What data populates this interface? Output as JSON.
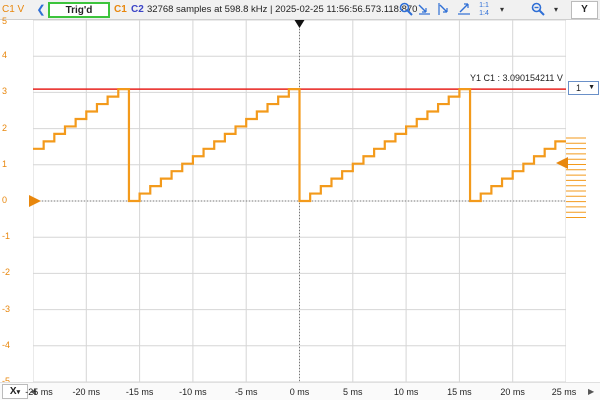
{
  "toolbar": {
    "unit_label": "C1 V",
    "back_icon": "chevron-left-icon",
    "trigger_status": "Trig'd",
    "channel1": "C1",
    "channel2": "C2",
    "acquisition_info": "32768 samples at 598.8 kHz  |  2025-02-25 11:56:56.573.118.870",
    "tools": [
      "zoom-icon",
      "zoom-x-icon",
      "zoom-y-icon",
      "zoom-xy-icon",
      "ratio-icon",
      "zoom-out-icon",
      "zoom-settings-icon"
    ],
    "y_axis_select": "Y"
  },
  "plot": {
    "y_ticks": [
      "5",
      "4",
      "3",
      "2",
      "1",
      "0",
      "-1",
      "-2",
      "-3",
      "-4",
      "-5"
    ],
    "x_ticks": [
      "-25 ms",
      "-20 ms",
      "-15 ms",
      "-10 ms",
      "-5 ms",
      "0 ms",
      "5 ms",
      "10 ms",
      "15 ms",
      "20 ms",
      "25 ms"
    ],
    "cursor_label": "Y1 C1 : 3.090154211 V",
    "cursor_channel_select": "1",
    "x_axis_select": "X",
    "colors": {
      "trace": "#f39a1b",
      "cursor": "#e8221e",
      "grid": "#d6d6d6",
      "marker": "#e8870d"
    }
  },
  "chart_data": {
    "type": "line",
    "xlabel": "",
    "ylabel": "",
    "xlim": [
      -25,
      25
    ],
    "ylim": [
      -5,
      5
    ],
    "x_unit": "ms",
    "y_unit": "V",
    "grid": true,
    "series": [
      {
        "waveform": "staircase sawtooth",
        "period_ms": 16.0,
        "reset_times_ms": [
          -16.0,
          0.0,
          16.0
        ],
        "steps_per_period": 16,
        "min_v": 0.0,
        "max_v": 3.09
      }
    ],
    "cursors": [
      {
        "type": "horizontal",
        "channel": "C1",
        "value": 3.090154211
      }
    ],
    "trigger_time_ms": 0,
    "trigger_level_v": 1.05
  }
}
